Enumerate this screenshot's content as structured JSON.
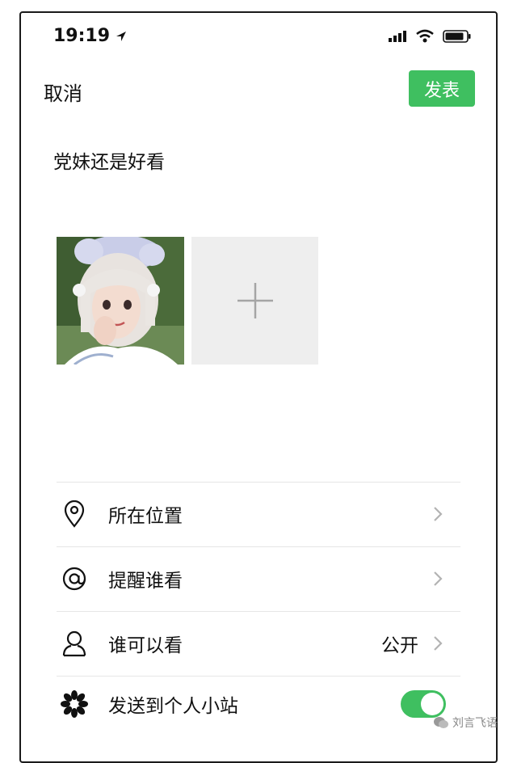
{
  "status_bar": {
    "time": "19:19"
  },
  "header": {
    "cancel_label": "取消",
    "publish_label": "发表"
  },
  "post": {
    "text": "党妹还是好看"
  },
  "options": [
    {
      "icon": "location-pin-icon",
      "label": "所在位置",
      "value": ""
    },
    {
      "icon": "at-sign-icon",
      "label": "提醒谁看",
      "value": ""
    },
    {
      "icon": "person-icon",
      "label": "谁可以看",
      "value": "公开"
    },
    {
      "icon": "flower-icon",
      "label": "发送到个人小站",
      "toggle_on": true
    }
  ],
  "watermark": {
    "text": "刘言飞语"
  },
  "colors": {
    "accent": "#3fbf60",
    "add_tile_bg": "#eeeeee",
    "divider": "#e6e6e6"
  }
}
